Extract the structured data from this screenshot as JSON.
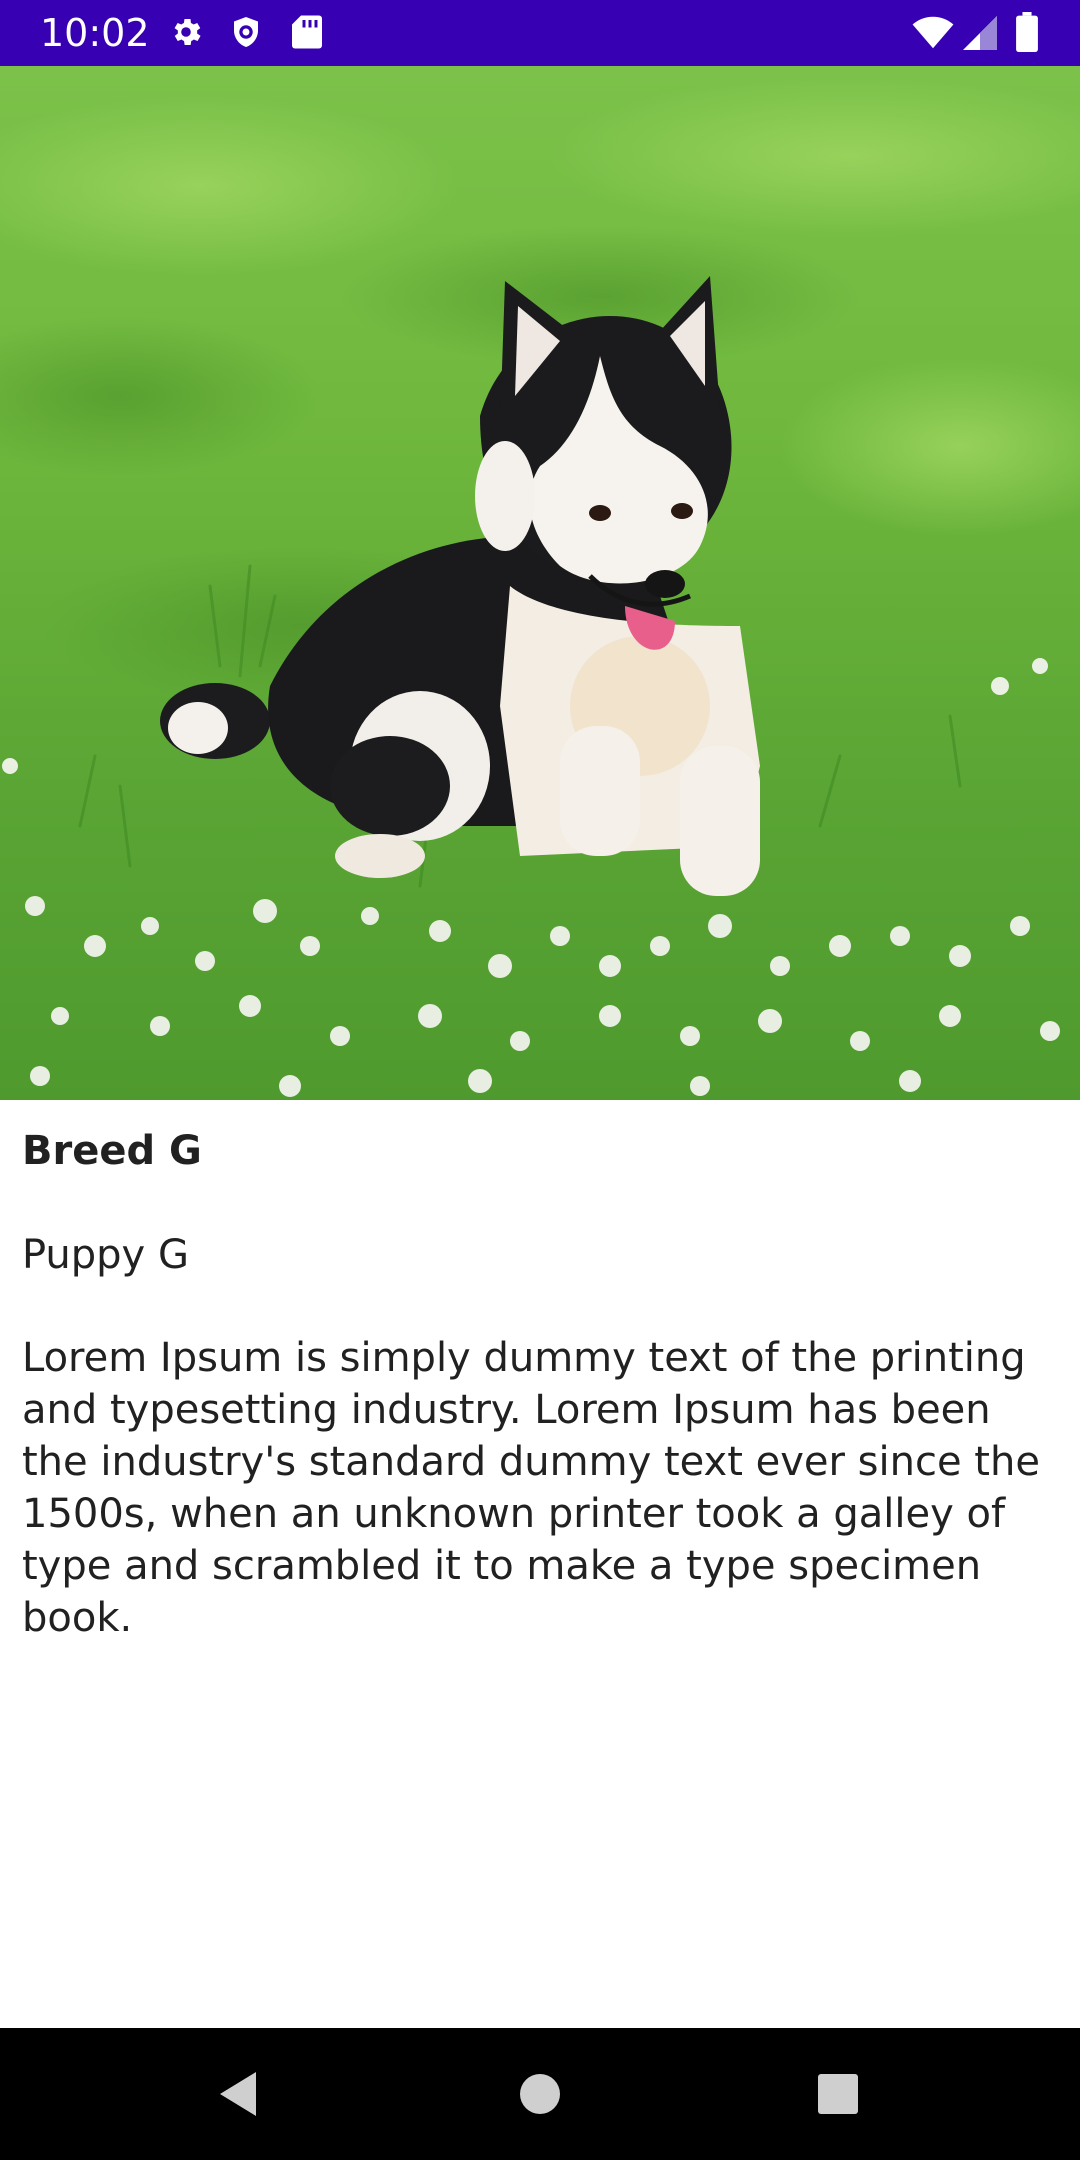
{
  "status_bar": {
    "time": "10:02",
    "left_icons": [
      "gear-icon",
      "shield-icon",
      "sd-card-icon"
    ],
    "right_icons": [
      "wifi-icon",
      "signal-icon",
      "battery-icon"
    ],
    "background": "#3700b3"
  },
  "hero_image": {
    "subject": "husky puppy sitting in grass",
    "icon": "dog-photo"
  },
  "detail": {
    "breed": "Breed G",
    "name": "Puppy G",
    "description": "Lorem Ipsum is simply dummy text of the printing and typesetting industry. Lorem Ipsum has been the industry's standard dummy text ever since the 1500s, when an unknown printer took a galley of type and scrambled it to make a type specimen book."
  },
  "nav_bar": {
    "buttons": [
      "back-icon",
      "home-icon",
      "recents-icon"
    ]
  }
}
